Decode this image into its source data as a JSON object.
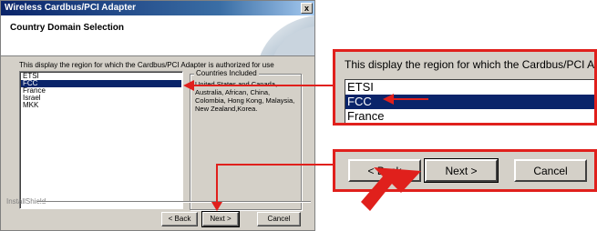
{
  "dialog": {
    "title": "Wireless Cardbus/PCI Adapter",
    "close_label": "x",
    "header_title": "Country Domain Selection",
    "description": "This display the region for which the Cardbus/PCI Adapter is authorized for use",
    "regions": [
      "ETSI",
      "FCC",
      "France",
      "Israel",
      "MKK"
    ],
    "selected_region": "FCC",
    "group_label": "Countries Included",
    "group_text": "United States and Canada, Australia, African, China, Colombia, Hong Kong, Malaysia, New Zealand,Korea.",
    "installshield_label": "InstallShield",
    "buttons": {
      "back": "< Back",
      "next": "Next >",
      "cancel": "Cancel"
    }
  },
  "zoom_list": {
    "description": "This display the region for which the Cardbus/PCI A",
    "items": [
      "ETSI",
      "FCC",
      "France"
    ]
  },
  "zoom_buttons": {
    "back": "< Back",
    "next": "Next >",
    "cancel": "Cancel"
  },
  "colors": {
    "annotation_red": "#e0201c",
    "selection_navy": "#0a246a",
    "dialog_face": "#d4d0c8"
  }
}
